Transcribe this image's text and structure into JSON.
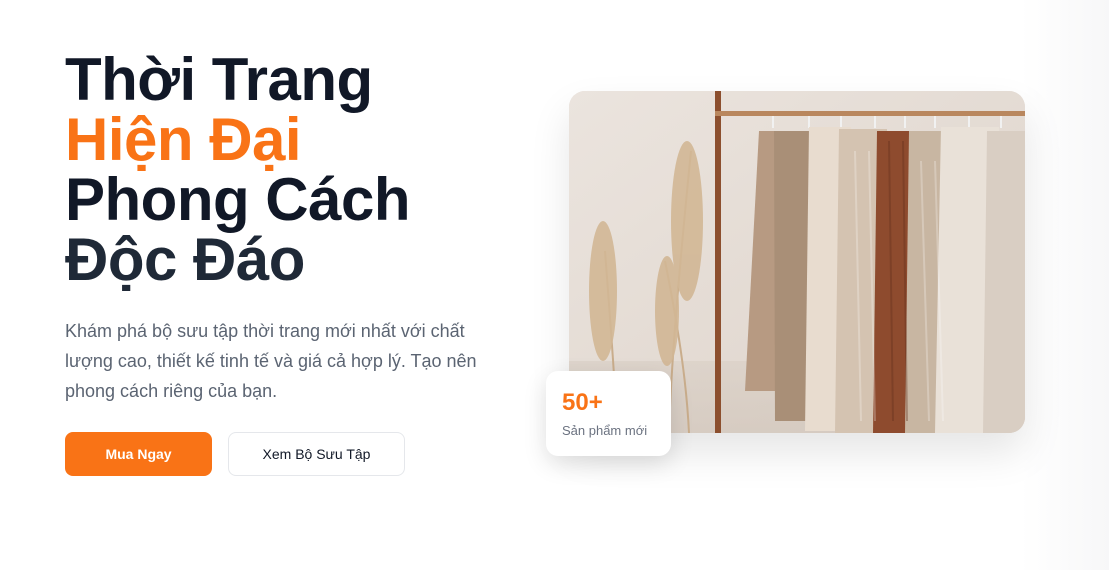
{
  "hero": {
    "headline": {
      "line1": "Thời Trang",
      "line2": "Hiện Đại",
      "line3": "Phong Cách",
      "line4": "Độc Đáo"
    },
    "description": "Khám phá bộ sưu tập thời trang mới nhất với chất lượng cao, thiết kế tinh tế và giá cả hợp lý. Tạo nên phong cách riêng của bạn.",
    "primary_button": "Mua Ngay",
    "secondary_button": "Xem Bộ Sưu Tập"
  },
  "stat": {
    "value": "50+",
    "label": "Sản phẩm mới"
  },
  "colors": {
    "accent": "#f97316",
    "heading": "#111827",
    "body_text": "#5b6472"
  }
}
